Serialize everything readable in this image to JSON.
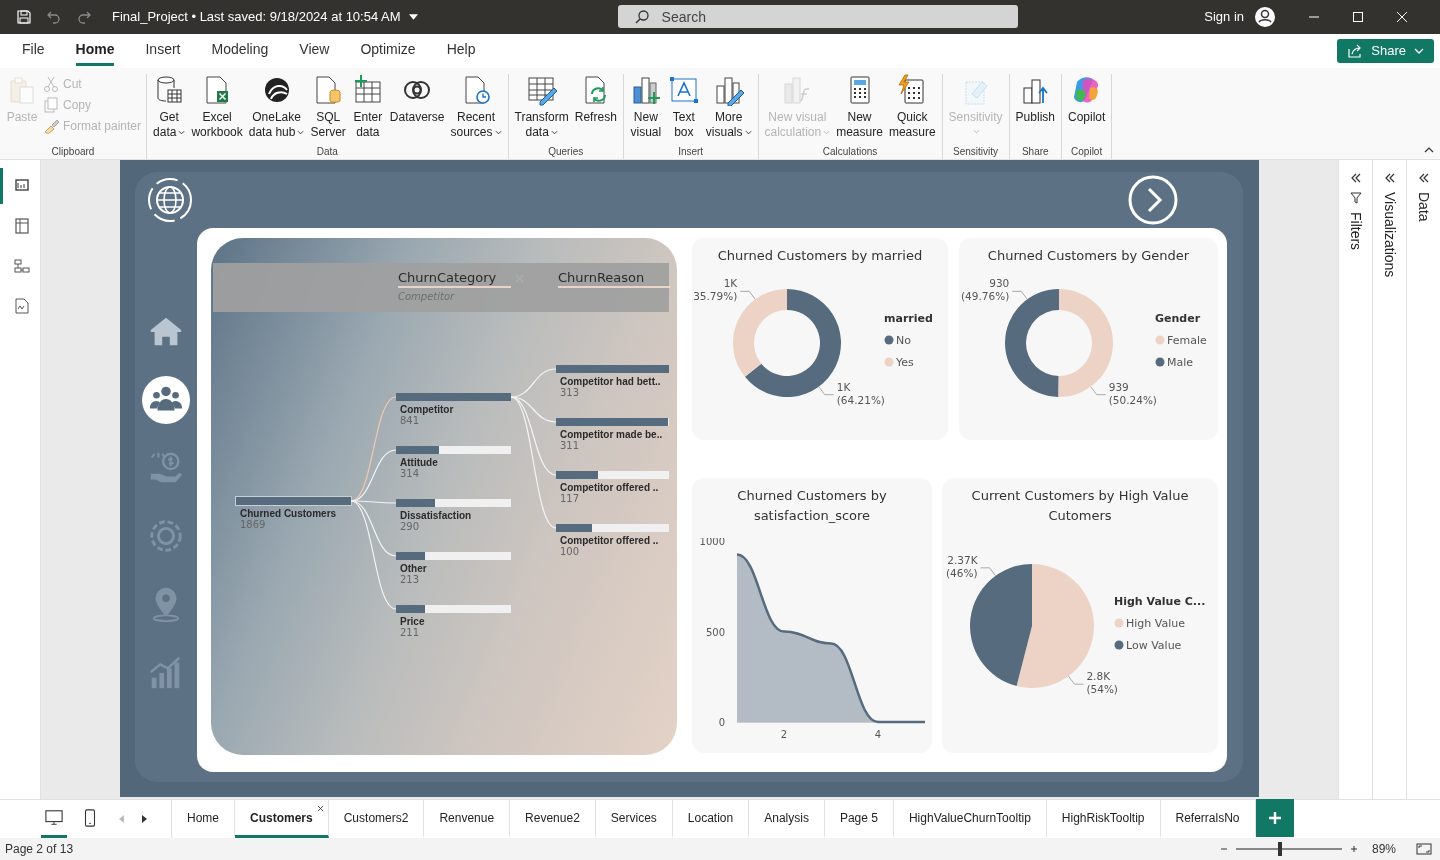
{
  "window": {
    "title": "Final_Project • Last saved: 9/18/2024 at 10:54 AM",
    "search": {
      "placeholder": "Search"
    },
    "sign_in": "Sign in"
  },
  "menu": {
    "tabs": [
      {
        "label": "File",
        "selected": false
      },
      {
        "label": "Home",
        "selected": true
      },
      {
        "label": "Insert",
        "selected": false
      },
      {
        "label": "Modeling",
        "selected": false
      },
      {
        "label": "View",
        "selected": false
      },
      {
        "label": "Optimize",
        "selected": false
      },
      {
        "label": "Help",
        "selected": false
      }
    ],
    "share": "Share"
  },
  "ribbon": {
    "groups": [
      {
        "label": "Clipboard",
        "buttons": [
          {
            "lines": [
              "Paste"
            ],
            "dropdown": false,
            "disabled": true
          }
        ],
        "small": [
          {
            "label": "Cut",
            "disabled": true
          },
          {
            "label": "Copy",
            "disabled": true
          },
          {
            "label": "Format painter",
            "disabled": true
          }
        ]
      },
      {
        "label": "Data",
        "buttons": [
          {
            "lines": [
              "Get",
              "data"
            ],
            "dropdown": true,
            "disabled": false
          },
          {
            "lines": [
              "Excel",
              "workbook"
            ],
            "dropdown": false,
            "disabled": false
          },
          {
            "lines": [
              "OneLake",
              "data hub"
            ],
            "dropdown": true,
            "disabled": false
          },
          {
            "lines": [
              "SQL",
              "Server"
            ],
            "dropdown": false,
            "disabled": false
          },
          {
            "lines": [
              "Enter",
              "data"
            ],
            "dropdown": false,
            "disabled": false
          },
          {
            "lines": [
              "Dataverse"
            ],
            "dropdown": false,
            "disabled": false
          },
          {
            "lines": [
              "Recent",
              "sources"
            ],
            "dropdown": true,
            "disabled": false
          }
        ]
      },
      {
        "label": "Queries",
        "buttons": [
          {
            "lines": [
              "Transform",
              "data"
            ],
            "dropdown": true,
            "disabled": false
          },
          {
            "lines": [
              "Refresh"
            ],
            "dropdown": false,
            "disabled": false
          }
        ]
      },
      {
        "label": "Insert",
        "buttons": [
          {
            "lines": [
              "New",
              "visual"
            ],
            "dropdown": false,
            "disabled": false
          },
          {
            "lines": [
              "Text",
              "box"
            ],
            "dropdown": false,
            "disabled": false
          },
          {
            "lines": [
              "More",
              "visuals"
            ],
            "dropdown": true,
            "disabled": false
          }
        ]
      },
      {
        "label": "Calculations",
        "buttons": [
          {
            "lines": [
              "New visual",
              "calculation"
            ],
            "dropdown": true,
            "disabled": true
          },
          {
            "lines": [
              "New",
              "measure"
            ],
            "dropdown": false,
            "disabled": false
          },
          {
            "lines": [
              "Quick",
              "measure"
            ],
            "dropdown": false,
            "disabled": false
          }
        ]
      },
      {
        "label": "Sensitivity",
        "buttons": [
          {
            "lines": [
              "Sensitivity"
            ],
            "dropdown": true,
            "disabled": true
          }
        ]
      },
      {
        "label": "Share",
        "buttons": [
          {
            "lines": [
              "Publish"
            ],
            "dropdown": false,
            "disabled": false
          }
        ]
      },
      {
        "label": "Copilot",
        "buttons": [
          {
            "lines": [
              "Copilot"
            ],
            "dropdown": false,
            "disabled": false
          }
        ]
      }
    ]
  },
  "views": [
    {
      "selected": true
    },
    {
      "selected": false
    },
    {
      "selected": false
    },
    {
      "selected": false
    }
  ],
  "report": {
    "nav": [
      {
        "selected": false
      },
      {
        "selected": true
      },
      {
        "selected": false
      },
      {
        "selected": false
      },
      {
        "selected": false
      },
      {
        "selected": false
      }
    ],
    "tree": {
      "levels": [
        {
          "title": "ChurnCategory",
          "filter": "Competitor",
          "closable": true
        },
        {
          "title": "ChurnReason",
          "closable": false
        }
      ],
      "root": {
        "label": "Churned Customers",
        "value": "1869",
        "level": 1,
        "children": [
          {
            "label": "Competitor",
            "value": "841",
            "level": 1,
            "selected": true,
            "children": [
              {
                "label": "Competitor had bett..",
                "value": "313",
                "level": 1
              },
              {
                "label": "Competitor made be..",
                "value": "311",
                "level": 0.99
              },
              {
                "label": "Competitor offered ..",
                "value": "117",
                "level": 0.37
              },
              {
                "label": "Competitor offered ..",
                "value": "100",
                "level": 0.32
              }
            ]
          },
          {
            "label": "Attitude",
            "value": "314",
            "level": 0.37,
            "selected": false
          },
          {
            "label": "Dissatisfaction",
            "value": "290",
            "level": 0.34,
            "selected": false
          },
          {
            "label": "Other",
            "value": "213",
            "level": 0.25,
            "selected": false
          },
          {
            "label": "Price",
            "value": "211",
            "level": 0.25,
            "selected": false
          }
        ]
      }
    },
    "cards": [
      {
        "chart_data": {
          "type": "donut",
          "title": "Churned Customers by married",
          "legend": {
            "title": "married"
          },
          "categories": [
            "No",
            "Yes"
          ],
          "colors": [
            "#566b7e",
            "#ecd3c5"
          ],
          "values": [
            64.21,
            35.79
          ],
          "value_labels": [
            [
              "1K",
              "(64.21%)"
            ],
            [
              "1K",
              "(35.79%)"
            ]
          ]
        }
      },
      {
        "chart_data": {
          "type": "donut",
          "title": "Churned Customers by Gender",
          "legend": {
            "title": "Gender"
          },
          "categories": [
            "Female",
            "Male"
          ],
          "colors": [
            "#ecd3c5",
            "#566b7e"
          ],
          "values": [
            50.24,
            49.76
          ],
          "value_labels": [
            [
              "939",
              "(50.24%)"
            ],
            [
              "930",
              "(49.76%)"
            ]
          ]
        }
      },
      {
        "chart_data": {
          "type": "area",
          "title": "Churned Customers by satisfaction_score",
          "x": [
            1,
            2,
            3,
            4,
            5
          ],
          "xlim": [
            1,
            5
          ],
          "series": [
            {
              "color": "#566b7e",
              "values": [
                925,
                500,
                434,
                0,
                0
              ]
            }
          ],
          "ylim": [
            0,
            1000
          ],
          "xticks": [
            {
              "value": 2,
              "label": "2"
            },
            {
              "value": 4,
              "label": "4"
            }
          ],
          "yticks": [
            {
              "value": 0,
              "label": "0"
            },
            {
              "value": 500,
              "label": "500"
            },
            {
              "value": 1000,
              "label": "1000"
            }
          ]
        }
      },
      {
        "chart_data": {
          "type": "pie",
          "title": "Current Customers by High Value Cutomers",
          "legend": {
            "title": "High Value C..."
          },
          "categories": [
            "High Value",
            "Low Value"
          ],
          "colors": [
            "#ecd3c5",
            "#566b7e"
          ],
          "values": [
            54,
            46
          ],
          "value_labels": [
            [
              "2.8K",
              "(54%)"
            ],
            [
              "2.37K",
              "(46%)"
            ]
          ]
        }
      }
    ]
  },
  "panes": [
    {
      "label": "Filters",
      "filter_icon": true
    },
    {
      "label": "Visualizations",
      "filter_icon": false
    },
    {
      "label": "Data",
      "filter_icon": false
    }
  ],
  "page_views": [
    {
      "selected": true
    },
    {
      "selected": false
    }
  ],
  "pages": [
    {
      "label": "Home",
      "selected": false
    },
    {
      "label": "Customers",
      "selected": true
    },
    {
      "label": "Customers2",
      "selected": false
    },
    {
      "label": "Renvenue",
      "selected": false
    },
    {
      "label": "Revenue2",
      "selected": false
    },
    {
      "label": "Services",
      "selected": false
    },
    {
      "label": "Location",
      "selected": false
    },
    {
      "label": "Analysis",
      "selected": false
    },
    {
      "label": "Page 5",
      "selected": false
    },
    {
      "label": "HighValueChurnTooltip",
      "selected": false
    },
    {
      "label": "HighRiskTooltip",
      "selected": false
    },
    {
      "label": "ReferralsNo",
      "selected": false
    }
  ],
  "status_bar": {
    "page": "Page 2 of 13",
    "zoom": {
      "level": 0.42,
      "reading": "89%"
    }
  }
}
